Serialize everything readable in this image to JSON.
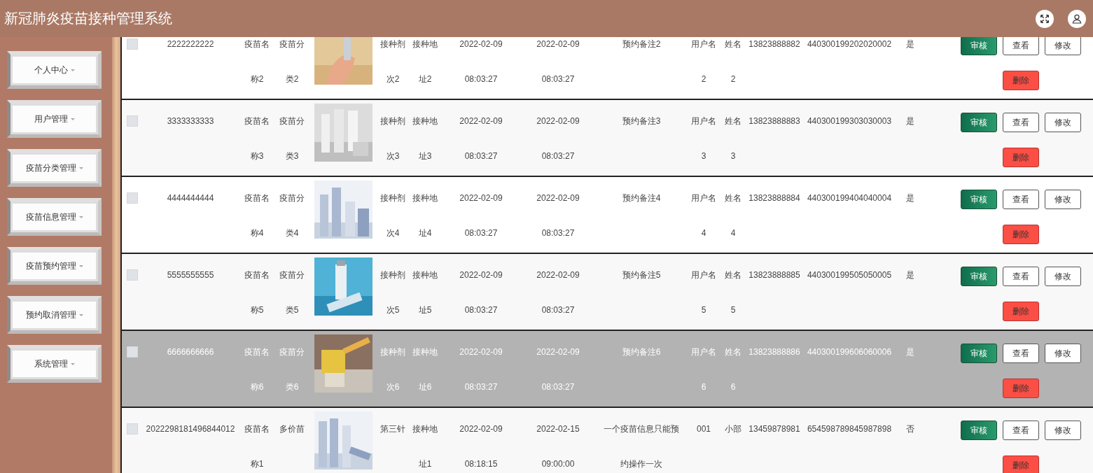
{
  "header": {
    "title": "新冠肺炎疫苗接种管理系统"
  },
  "sidebar": {
    "items": [
      {
        "label": "个人中心"
      },
      {
        "label": "用户管理"
      },
      {
        "label": "疫苗分类管理"
      },
      {
        "label": "疫苗信息管理"
      },
      {
        "label": "疫苗预约管理"
      },
      {
        "label": "预约取消管理"
      },
      {
        "label": "系统管理"
      }
    ]
  },
  "table": {
    "rows": [
      {
        "checked": false,
        "highlighted": false,
        "cells": [
          "2222222222",
          "疫苗名称2",
          "疫苗分类2",
          "接种剂次2",
          "接种地址2",
          "2022-02-09 08:03:27",
          "2022-02-09 08:03:27",
          "预约备注2",
          "用户名2",
          "姓名2",
          "13823888882",
          "440300199202020002",
          "是"
        ],
        "actions": [
          {
            "label": "审核",
            "kind": "approve"
          },
          {
            "label": "查看",
            "kind": "view"
          },
          {
            "label": "修改",
            "kind": "edit"
          },
          {
            "label": "删除",
            "kind": "delete"
          }
        ]
      },
      {
        "checked": false,
        "highlighted": false,
        "cells": [
          "3333333333",
          "疫苗名称3",
          "疫苗分类3",
          "接种剂次3",
          "接种地址3",
          "2022-02-09 08:03:27",
          "2022-02-09 08:03:27",
          "预约备注3",
          "用户名3",
          "姓名3",
          "13823888883",
          "440300199303030003",
          "是"
        ],
        "actions": [
          {
            "label": "审核",
            "kind": "approve"
          },
          {
            "label": "查看",
            "kind": "view"
          },
          {
            "label": "修改",
            "kind": "edit"
          },
          {
            "label": "删除",
            "kind": "delete"
          }
        ]
      },
      {
        "checked": false,
        "highlighted": false,
        "cells": [
          "4444444444",
          "疫苗名称4",
          "疫苗分类4",
          "接种剂次4",
          "接种地址4",
          "2022-02-09 08:03:27",
          "2022-02-09 08:03:27",
          "预约备注4",
          "用户名4",
          "姓名4",
          "13823888884",
          "440300199404040004",
          "是"
        ],
        "actions": [
          {
            "label": "审核",
            "kind": "approve"
          },
          {
            "label": "查看",
            "kind": "view"
          },
          {
            "label": "修改",
            "kind": "edit"
          },
          {
            "label": "删除",
            "kind": "delete"
          }
        ]
      },
      {
        "checked": false,
        "highlighted": false,
        "cells": [
          "5555555555",
          "疫苗名称5",
          "疫苗分类5",
          "接种剂次5",
          "接种地址5",
          "2022-02-09 08:03:27",
          "2022-02-09 08:03:27",
          "预约备注5",
          "用户名5",
          "姓名5",
          "13823888885",
          "440300199505050005",
          "是"
        ],
        "actions": [
          {
            "label": "审核",
            "kind": "approve"
          },
          {
            "label": "查看",
            "kind": "view"
          },
          {
            "label": "修改",
            "kind": "edit"
          },
          {
            "label": "删除",
            "kind": "delete"
          }
        ]
      },
      {
        "checked": false,
        "highlighted": true,
        "cells": [
          "6666666666",
          "疫苗名称6",
          "疫苗分类6",
          "接种剂次6",
          "接种地址6",
          "2022-02-09 08:03:27",
          "2022-02-09 08:03:27",
          "预约备注6",
          "用户名6",
          "姓名6",
          "13823888886",
          "440300199606060006",
          "是"
        ],
        "actions": [
          {
            "label": "审核",
            "kind": "approve"
          },
          {
            "label": "查看",
            "kind": "view"
          },
          {
            "label": "修改",
            "kind": "edit"
          },
          {
            "label": "删除",
            "kind": "delete"
          }
        ]
      },
      {
        "checked": false,
        "highlighted": false,
        "cells": [
          "2022298181496844012",
          "疫苗名称1",
          "多价苗",
          "第三针",
          "接种地址1",
          "2022-02-09 08:18:15",
          "2022-02-15 09:00:00",
          "一个疫苗信息只能预约操作一次",
          "001",
          "小部",
          "13459878981",
          "654598789845987898",
          "否"
        ],
        "actions": [
          {
            "label": "审核",
            "kind": "approve"
          },
          {
            "label": "查看",
            "kind": "view"
          },
          {
            "label": "修改",
            "kind": "edit"
          },
          {
            "label": "删除",
            "kind": "delete"
          }
        ]
      }
    ]
  }
}
